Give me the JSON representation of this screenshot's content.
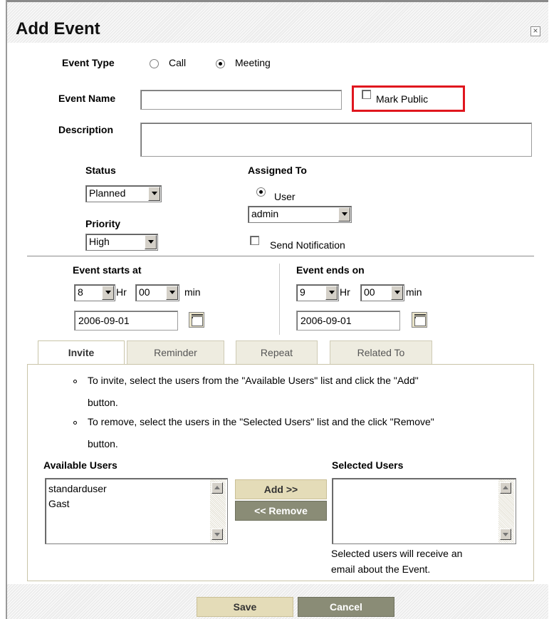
{
  "dialog": {
    "title": "Add Event",
    "close_label": "×"
  },
  "event_type": {
    "label": "Event Type",
    "options": [
      {
        "label": "Call",
        "checked": false
      },
      {
        "label": "Meeting",
        "checked": true
      }
    ]
  },
  "event_name": {
    "label": "Event Name",
    "value": "",
    "mark_public_label": "Mark Public",
    "mark_public_checked": false,
    "highlight_color": "#e0161e"
  },
  "description": {
    "label": "Description",
    "value": ""
  },
  "status": {
    "label": "Status",
    "selected": "Planned"
  },
  "priority": {
    "label": "Priority",
    "selected": "High"
  },
  "assigned_to": {
    "label": "Assigned To",
    "radio_label": "User",
    "radio_checked": true,
    "user_selected": "admin",
    "send_notification_label": "Send Notification",
    "send_notification_checked": false
  },
  "starts": {
    "label": "Event starts at",
    "hour": "8",
    "hr_label": "Hr",
    "minute": "00",
    "min_label": "min",
    "date": "2006-09-01"
  },
  "ends": {
    "label": "Event ends on",
    "hour": "9",
    "hr_label": "Hr",
    "minute": "00",
    "min_label": "min",
    "date": "2006-09-01"
  },
  "tabs": [
    {
      "label": "Invite",
      "active": true
    },
    {
      "label": "Reminder",
      "active": false
    },
    {
      "label": "Repeat",
      "active": false
    },
    {
      "label": "Related To",
      "active": false
    }
  ],
  "invite": {
    "instruction_1_line1": "To invite, select the users from the \"Available Users\" list and click the \"Add\"",
    "instruction_1_line2": "button.",
    "instruction_2_line1": "To remove, select the users in the \"Selected Users\" list and the click \"Remove\"",
    "instruction_2_line2": "button.",
    "available_label": "Available Users",
    "available_users": [
      "standarduser",
      "Gast"
    ],
    "selected_label": "Selected Users",
    "selected_users": [],
    "add_label": "Add >>",
    "remove_label": "<< Remove",
    "note_line1": "Selected users will receive an",
    "note_line2": "email about the Event."
  },
  "footer": {
    "save_label": "Save",
    "cancel_label": "Cancel"
  },
  "colors": {
    "light_button": "#e4dcb8",
    "dark_button": "#8a8c76"
  }
}
